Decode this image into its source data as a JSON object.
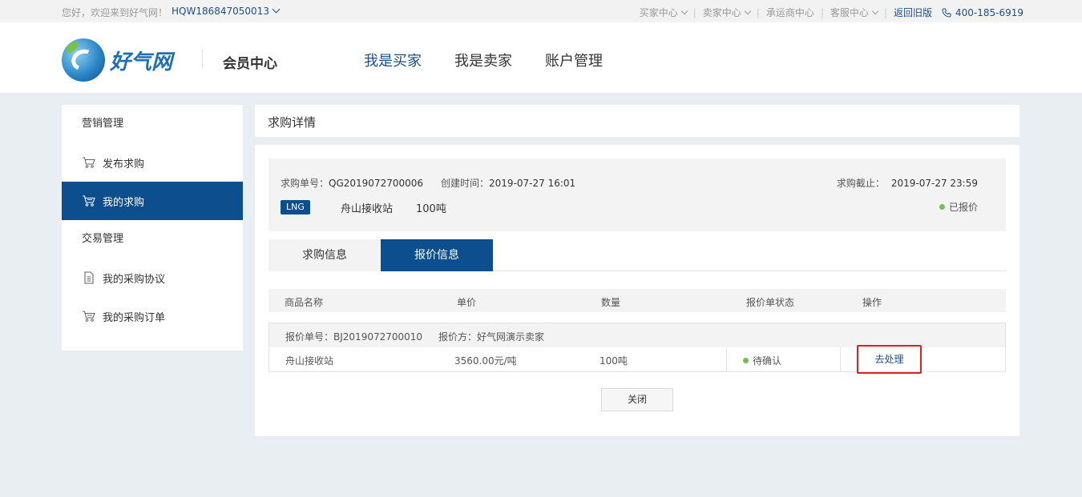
{
  "topbar": {
    "welcome": "您好，欢迎来到好气网！",
    "user_id": "HQW186847050013",
    "nav": [
      "买家中心",
      "卖家中心",
      "承运商中心",
      "客服中心"
    ],
    "back_old": "返回旧版",
    "phone": "400-185-6919"
  },
  "header": {
    "brand": "好气网",
    "section": "会员中心",
    "nav": [
      "我是买家",
      "我是卖家",
      "账户管理"
    ]
  },
  "sidebar": {
    "group1": "营销管理",
    "item1": "发布求购",
    "item2": "我的求购",
    "group2": "交易管理",
    "item3": "我的采购协议",
    "item4": "我的采购订单"
  },
  "page": {
    "title": "求购详情"
  },
  "summary": {
    "order_label": "求购单号：",
    "order_no": "QG2019072700006",
    "created_label": "创建时间：",
    "created": "2019-07-27 16:01",
    "deadline_label": "求购截止：",
    "deadline": "2019-07-27 23:59",
    "tag": "LNG",
    "station": "舟山接收站",
    "qty": "100吨",
    "status": "已报价"
  },
  "tabs": [
    "求购信息",
    "报价信息"
  ],
  "table": {
    "headers": [
      "商品名称",
      "单价",
      "数量",
      "报价单状态",
      "操作"
    ]
  },
  "quote": {
    "no_label": "报价单号：",
    "no": "BJ2019072700010",
    "party_label": "报价方：",
    "party": "好气网演示卖家",
    "product": "舟山接收站",
    "price": "3560.00元/吨",
    "qty": "100吨",
    "status": "待确认",
    "action": "去处理"
  },
  "close_label": "关闭",
  "colors": {
    "primary": "#0d4f8e",
    "status_green": "#6cc24a",
    "highlight_red": "#e02020"
  }
}
